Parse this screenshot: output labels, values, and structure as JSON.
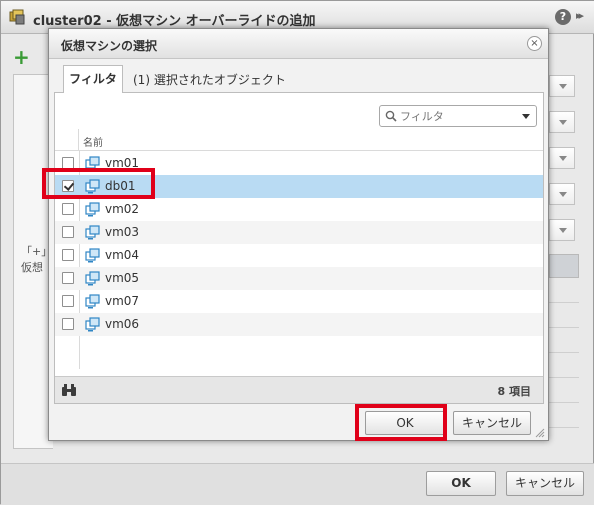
{
  "outer_dialog": {
    "title": "cluster02 - 仮想マシン オーバーライドの追加",
    "help_label": "?",
    "expand_label": "▸▸",
    "add_label": "+",
    "left_text_line1": "「+」",
    "left_text_line2": "仮想",
    "ok_label": "OK",
    "cancel_label": "キャンセル"
  },
  "modal": {
    "title": "仮想マシンの選択",
    "close_label": "×",
    "tabs": [
      {
        "label": "フィルタ",
        "active": true
      },
      {
        "label": "(1) 選択されたオブジェクト",
        "active": false
      }
    ],
    "filter": {
      "placeholder": "フィルタ",
      "value": ""
    },
    "table": {
      "column_name": "名前",
      "rows": [
        {
          "name": "vm01",
          "checked": false,
          "selected": false
        },
        {
          "name": "db01",
          "checked": true,
          "selected": true
        },
        {
          "name": "vm02",
          "checked": false,
          "selected": false
        },
        {
          "name": "vm03",
          "checked": false,
          "selected": false
        },
        {
          "name": "vm04",
          "checked": false,
          "selected": false
        },
        {
          "name": "vm05",
          "checked": false,
          "selected": false
        },
        {
          "name": "vm07",
          "checked": false,
          "selected": false
        },
        {
          "name": "vm06",
          "checked": false,
          "selected": false
        }
      ]
    },
    "item_count": "8 項目",
    "ok_label": "OK",
    "cancel_label": "キャンセル"
  },
  "colors": {
    "highlight": "#e00019",
    "selected_row": "#b9dbf3",
    "add_icon": "#3a9b36"
  },
  "icons": {
    "vm": "vm-icon",
    "search": "search-icon",
    "binoculars": "binoculars-icon",
    "close": "close-icon",
    "help": "help-icon",
    "cluster": "cluster-icon"
  }
}
